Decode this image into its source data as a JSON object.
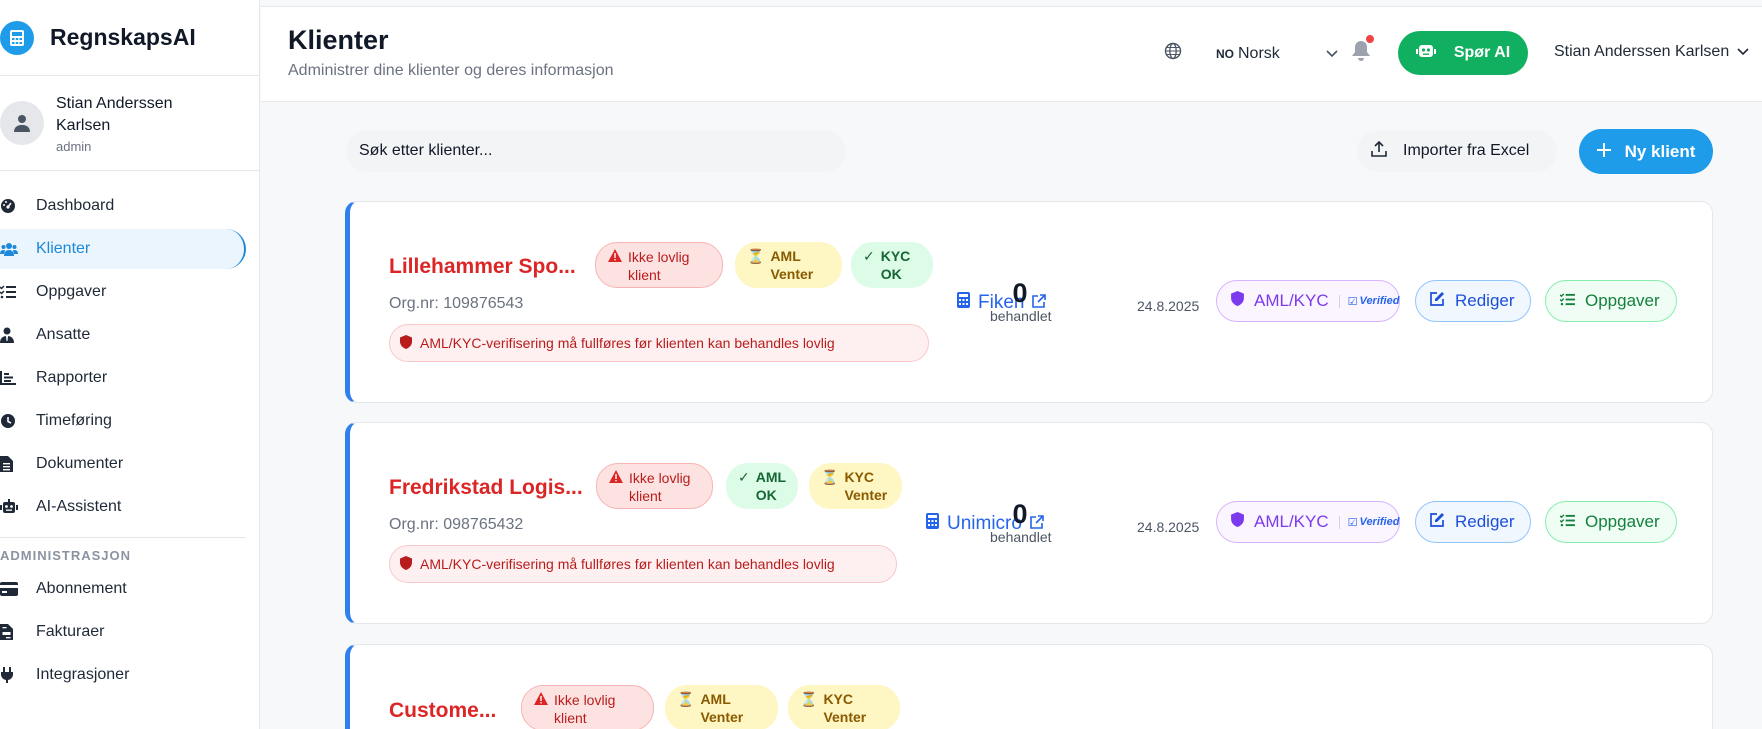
{
  "brand": {
    "name": "RegnskapsAI"
  },
  "sidebar": {
    "user": {
      "name_line1": "Stian Anderssen",
      "name_line2": "Karlsen",
      "role": "admin"
    },
    "items": [
      {
        "label": "Dashboard",
        "icon": "gauge-icon"
      },
      {
        "label": "Klienter",
        "icon": "users-icon",
        "active": true
      },
      {
        "label": "Oppgaver",
        "icon": "list-check-icon"
      },
      {
        "label": "Ansatte",
        "icon": "user-tie-icon"
      },
      {
        "label": "Rapporter",
        "icon": "chart-bar-icon"
      },
      {
        "label": "Timeføring",
        "icon": "clock-icon"
      },
      {
        "label": "Dokumenter",
        "icon": "file-icon"
      },
      {
        "label": "AI-Assistent",
        "icon": "robot-icon"
      }
    ],
    "section_admin": "ADMINISTRASJON",
    "admin_items": [
      {
        "label": "Abonnement",
        "icon": "credit-card-icon"
      },
      {
        "label": "Fakturaer",
        "icon": "invoice-icon"
      },
      {
        "label": "Integrasjoner",
        "icon": "plug-icon"
      }
    ]
  },
  "header": {
    "title": "Klienter",
    "subtitle": "Administrer dine klienter og deres informasjon",
    "lang_code": "NO",
    "lang_label": "Norsk",
    "ask_ai": "Spør AI",
    "user_name": "Stian Anderssen Karlsen"
  },
  "toolbar": {
    "search_placeholder": "Søk etter klienter...",
    "import_label": "Importer fra Excel",
    "new_client_label": "Ny klient"
  },
  "clients": [
    {
      "name": "Lillehammer Spo...",
      "badge_legal_l1": "Ikke lovlig",
      "badge_legal_l2": "klient",
      "badge_aml_l1": "AML",
      "badge_aml_l2": "Venter",
      "badge_kyc_l1": "KYC",
      "badge_kyc_l2": "OK",
      "orgnr": "Org.nr: 109876543",
      "warning": "AML/KYC-verifisering må fullføres før klienten kan behandles lovlig",
      "system": "Fiken",
      "processed": "0",
      "processed_label": "behandlet",
      "date": "24.8.2025",
      "aml_btn": "AML/KYC",
      "verified": "Verified",
      "edit_btn": "Rediger",
      "tasks_btn": "Oppgaver"
    },
    {
      "name": "Fredrikstad Logis...",
      "badge_legal_l1": "Ikke lovlig",
      "badge_legal_l2": "klient",
      "badge_aml_l1": "AML",
      "badge_aml_l2": "OK",
      "badge_kyc_l1": "KYC",
      "badge_kyc_l2": "Venter",
      "orgnr": "Org.nr: 098765432",
      "warning": "AML/KYC-verifisering må fullføres før klienten kan behandles lovlig",
      "system": "Unimicro",
      "processed": "0",
      "processed_label": "behandlet",
      "date": "24.8.2025",
      "aml_btn": "AML/KYC",
      "verified": "Verified",
      "edit_btn": "Rediger",
      "tasks_btn": "Oppgaver"
    },
    {
      "name": "Custome...",
      "badge_legal_l1": "Ikke lovlig",
      "badge_legal_l2": "klient",
      "badge_aml_l1": "AML",
      "badge_aml_l2": "Venter",
      "badge_kyc_l1": "KYC",
      "badge_kyc_l2": "Venter"
    }
  ],
  "colors": {
    "accent": "#1e9be9",
    "danger": "#dc2626",
    "success": "#10b060",
    "card_border": "#2f80ed"
  }
}
